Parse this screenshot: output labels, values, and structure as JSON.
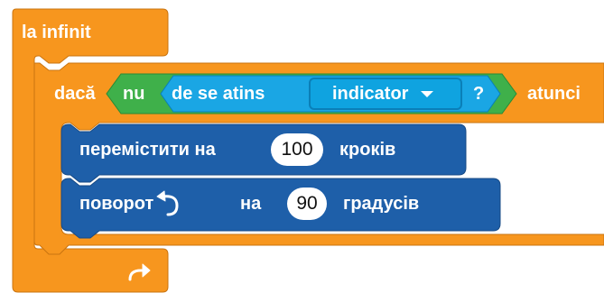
{
  "colors": {
    "control": "#f7961e",
    "control_dark": "#c97410",
    "operator": "#3fb04a",
    "operator_dark": "#2a8a35",
    "sensing": "#1aa6e4",
    "sensing_dark": "#0a7fb8",
    "motion": "#1e5fa9",
    "motion_dark": "#174a85"
  },
  "forever_block": {
    "label": "la infinit",
    "loop_icon": "loop-arrow-icon"
  },
  "if_block": {
    "label_if": "dacă",
    "label_then": "atunci"
  },
  "not_block": {
    "label": "nu"
  },
  "touching_block": {
    "label": "de se atins",
    "dropdown_value": "indicator",
    "question": "?"
  },
  "move_block": {
    "label_before": "перемістити на",
    "steps": "100",
    "label_after": "кроків"
  },
  "turn_block": {
    "label_before": "поворот",
    "icon": "rotate-left-icon",
    "label_mid": "на",
    "degrees": "90",
    "label_after": "градусів"
  }
}
